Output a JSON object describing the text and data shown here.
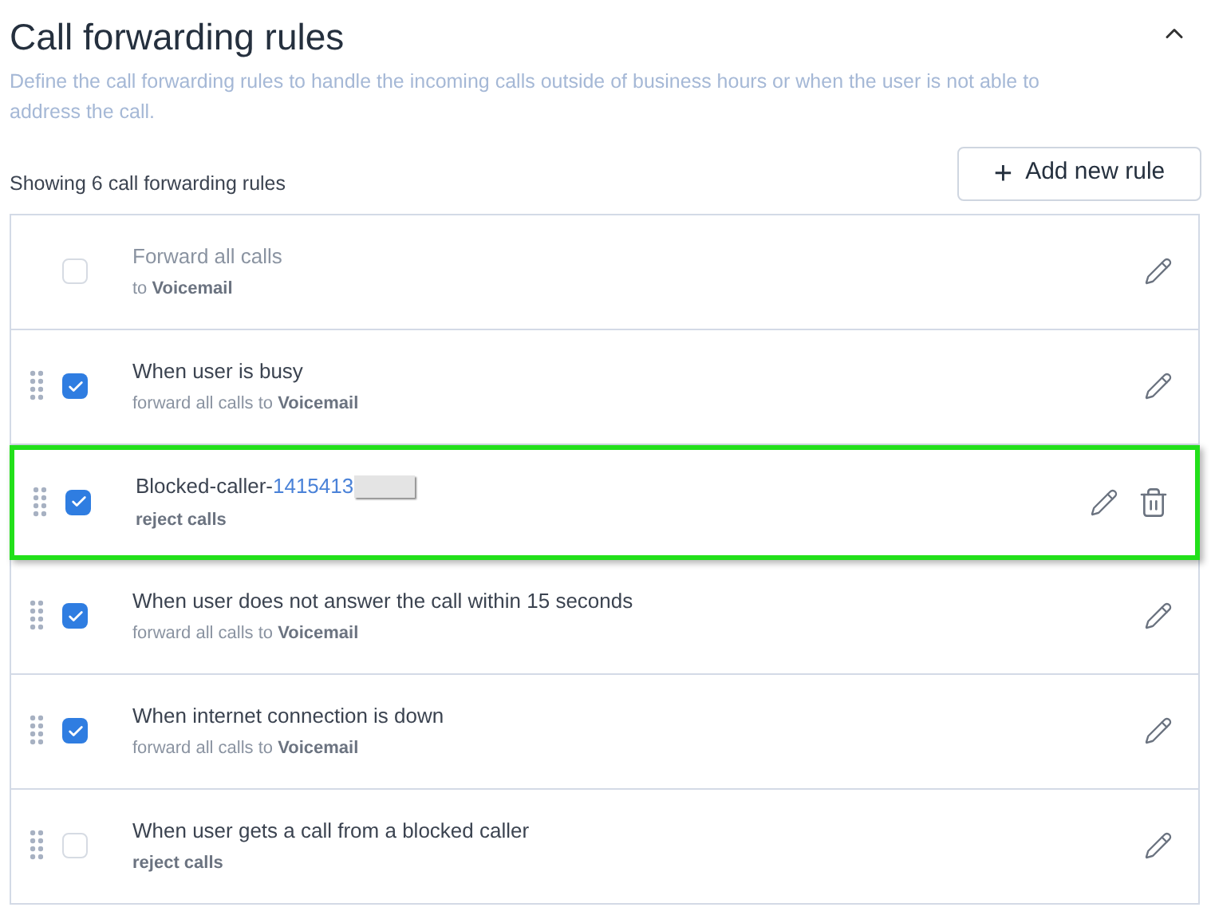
{
  "section": {
    "title": "Call forwarding rules",
    "expanded": true,
    "description": "Define the call forwarding rules to handle the incoming calls outside of business hours or when the user is not able to address the call."
  },
  "summary": "Showing 6 call forwarding rules",
  "add_button": {
    "icon": "+",
    "label": "Add new rule"
  },
  "rules": [
    {
      "title": "Forward all calls",
      "action": "to",
      "target": "Voicemail",
      "checked": false,
      "draggable": false,
      "muted": true,
      "selected": false,
      "deletable": false
    },
    {
      "title": "When user is busy",
      "action": "forward all calls to",
      "target": "Voicemail",
      "checked": true,
      "draggable": true,
      "muted": false,
      "selected": false,
      "deletable": false
    },
    {
      "title": "Blocked-caller-",
      "number": "1415413",
      "redacted": true,
      "target": "reject calls",
      "checked": true,
      "draggable": true,
      "muted": false,
      "selected": true,
      "deletable": true
    },
    {
      "title": "When user does not answer the call within 15 seconds",
      "action": "forward all calls to",
      "target": "Voicemail",
      "checked": true,
      "draggable": true,
      "muted": false,
      "selected": false,
      "deletable": false
    },
    {
      "title": "When internet connection is down",
      "action": "forward all calls to",
      "target": "Voicemail",
      "checked": true,
      "draggable": true,
      "muted": false,
      "selected": false,
      "deletable": false
    },
    {
      "title": "When user gets a call from a blocked caller",
      "target": "reject calls",
      "checked": false,
      "draggable": true,
      "muted": false,
      "selected": false,
      "deletable": false
    }
  ]
}
